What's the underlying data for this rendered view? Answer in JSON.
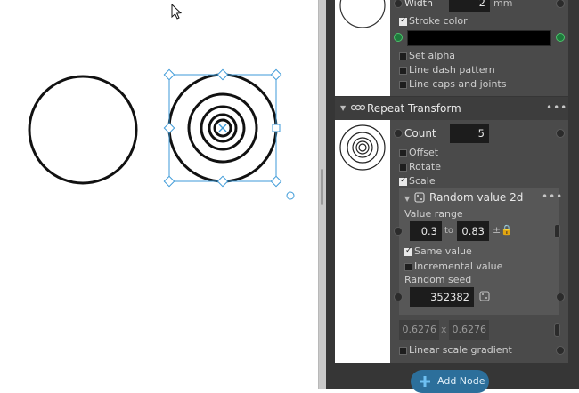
{
  "window": {
    "title": ""
  },
  "canvas": {
    "cursor_icon": "arrow-cursor-icon",
    "selection_color": "#3d9ad8",
    "shape_stroke": "#111111"
  },
  "stroke_node": {
    "width_label": "Width",
    "width_value": "2",
    "width_unit": "mm",
    "stroke_color_label": "Stroke color",
    "stroke_color_value": "#000000",
    "stroke_color_checked": true,
    "options": [
      {
        "label": "Set alpha",
        "checked": false
      },
      {
        "label": "Line dash pattern",
        "checked": false
      },
      {
        "label": "Line caps and joints",
        "checked": false
      }
    ]
  },
  "repeat_node": {
    "title": "Repeat Transform",
    "icon": "repeat-icon",
    "menu_label": "•••",
    "count_label": "Count",
    "count_value": "5",
    "options": [
      {
        "label": "Offset",
        "checked": false
      },
      {
        "label": "Rotate",
        "checked": false
      },
      {
        "label": "Scale",
        "checked": true
      }
    ]
  },
  "random_node": {
    "title": "Random value 2d",
    "icon": "dice-icon",
    "menu_label": "•••",
    "value_range_label": "Value range",
    "range_min": "0.3",
    "range_to": "to",
    "range_max": "0.83",
    "range_lock_label": "±",
    "same_value_label": "Same value",
    "same_value_checked": true,
    "incremental_label": "Incremental value",
    "incremental_checked": false,
    "seed_label": "Random seed",
    "seed_value": "352382"
  },
  "scale_output": {
    "x": "0.6276",
    "sep": "x",
    "y": "0.6276",
    "linear_gradient_label": "Linear scale gradient",
    "linear_gradient_checked": false
  },
  "add_node": {
    "label": "Add Node",
    "icon": "plus-icon"
  },
  "colors": {
    "panel_bg": "#363636",
    "node_bg": "#4a4a4a",
    "field_bg": "#1c1c1c",
    "accent": "#2c6f9b",
    "connector_green": "#4cc36b"
  }
}
